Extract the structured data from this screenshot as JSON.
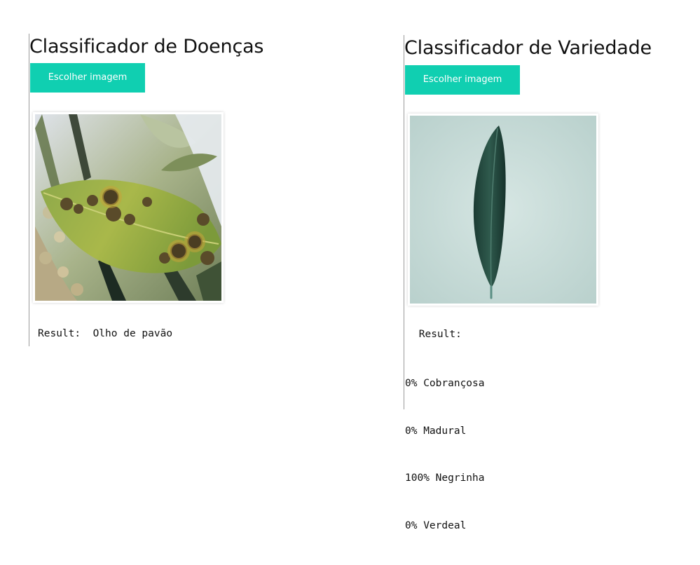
{
  "disease_panel": {
    "title": "Classificador de Doenças",
    "choose_button": "Escolher imagem",
    "result_label": "Result:",
    "result_value": "Olho de pavão"
  },
  "variety_panel": {
    "title": "Classificador de Variedade",
    "choose_button": "Escolher imagem",
    "result_label": "Result:",
    "results": [
      {
        "percent": "0%",
        "name": "Cobrançosa"
      },
      {
        "percent": "0%",
        "name": "Madural"
      },
      {
        "percent": "100%",
        "name": "Negrinha"
      },
      {
        "percent": "0%",
        "name": "Verdeal"
      }
    ]
  },
  "colors": {
    "button": "#10cfb1",
    "button_text": "#ffffff"
  }
}
